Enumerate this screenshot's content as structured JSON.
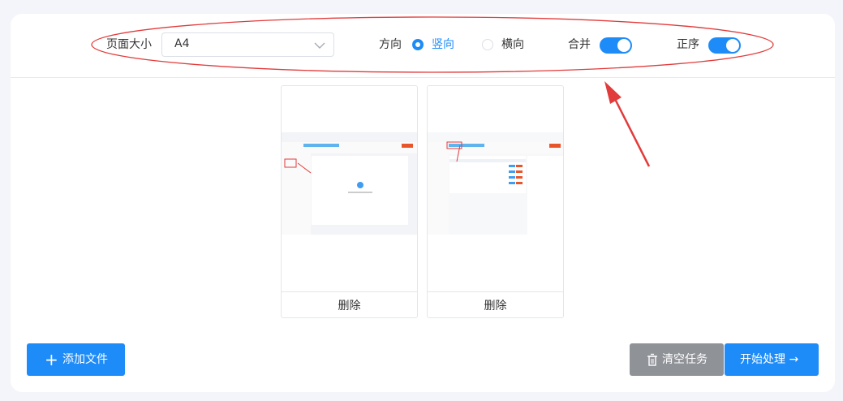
{
  "toolbar": {
    "page_size_label": "页面大小",
    "page_size_value": "A4",
    "direction_label": "方向",
    "portrait_label": "竖向",
    "landscape_label": "横向",
    "merge_label": "合并",
    "order_label": "正序",
    "orientation_selected": "竖向",
    "merge_on": true,
    "order_on": true
  },
  "files": [
    {
      "delete_label": "删除"
    },
    {
      "delete_label": "删除"
    }
  ],
  "footer": {
    "add_label": "添加文件",
    "clear_label": "清空任务",
    "start_label": "开始处理 →"
  },
  "colors": {
    "accent": "#1d8cf8",
    "gray_button": "#8f9297",
    "annotation": "#e23b3b"
  },
  "icons": [
    "chevron-down-icon",
    "plus-icon",
    "trash-icon",
    "arrow-right-icon"
  ]
}
